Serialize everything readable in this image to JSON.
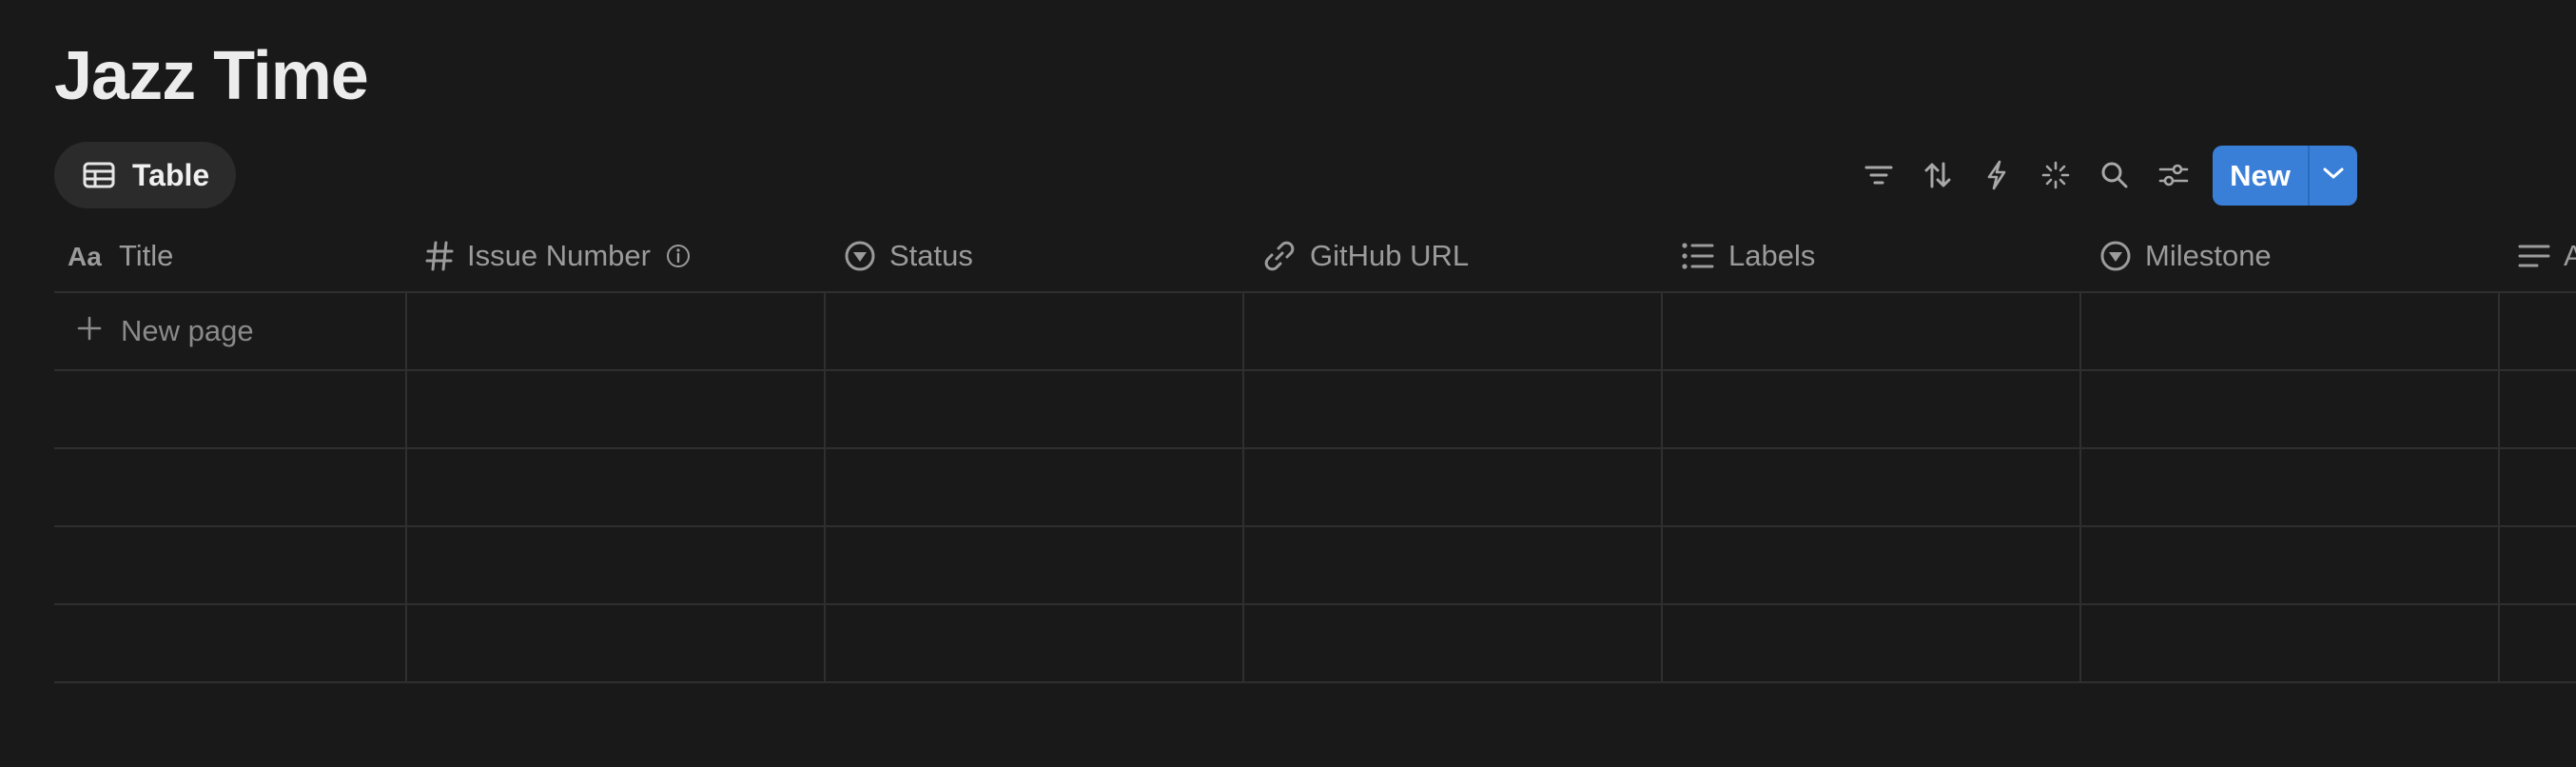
{
  "page": {
    "title": "Jazz Time"
  },
  "view": {
    "tab_label": "Table",
    "tab_icon": "table-icon"
  },
  "toolbar": {
    "icons": [
      "filter-icon",
      "sort-icon",
      "lightning-icon",
      "sparkle-icon",
      "search-icon",
      "settings-sliders-icon"
    ],
    "new_label": "New",
    "new_dropdown_icon": "chevron-down-icon",
    "accent_color": "#3a7fd7"
  },
  "table": {
    "columns": [
      {
        "label": "Title",
        "icon": "text-aa-icon"
      },
      {
        "label": "Issue Number",
        "icon": "hash-icon",
        "info_icon": "info-icon"
      },
      {
        "label": "Status",
        "icon": "status-circle-icon"
      },
      {
        "label": "GitHub URL",
        "icon": "link-icon"
      },
      {
        "label": "Labels",
        "icon": "list-icon"
      },
      {
        "label": "Milestone",
        "icon": "status-circle-icon"
      },
      {
        "label": "A",
        "icon": "text-lines-icon"
      }
    ],
    "new_page_label": "New page",
    "new_page_icon": "plus-icon",
    "empty_rows": 4
  }
}
